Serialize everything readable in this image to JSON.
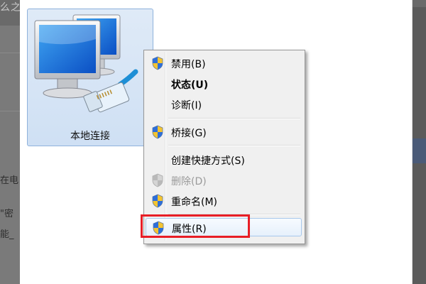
{
  "background": {
    "top_text": "么之",
    "left_fragments": [
      "在电",
      "\"密",
      "能_"
    ]
  },
  "adapter": {
    "label": "本地连接"
  },
  "menu": {
    "items": [
      {
        "label": "禁用(B)",
        "icon": "uac-shield-icon",
        "style": "normal"
      },
      {
        "label": "状态(U)",
        "icon": "",
        "style": "bold"
      },
      {
        "label": "诊断(I)",
        "icon": "",
        "style": "normal"
      },
      {
        "label": "桥接(G)",
        "icon": "uac-shield-icon",
        "style": "normal"
      },
      {
        "label": "创建快捷方式(S)",
        "icon": "",
        "style": "normal"
      },
      {
        "label": "删除(D)",
        "icon": "uac-shield-icon",
        "style": "disabled"
      },
      {
        "label": "重命名(M)",
        "icon": "uac-shield-icon",
        "style": "normal"
      },
      {
        "label": "属性(R)",
        "icon": "uac-shield-icon",
        "style": "hover"
      }
    ]
  },
  "colors": {
    "highlight_border": "#e81e26",
    "selection_blue": "#8fb2dc"
  }
}
